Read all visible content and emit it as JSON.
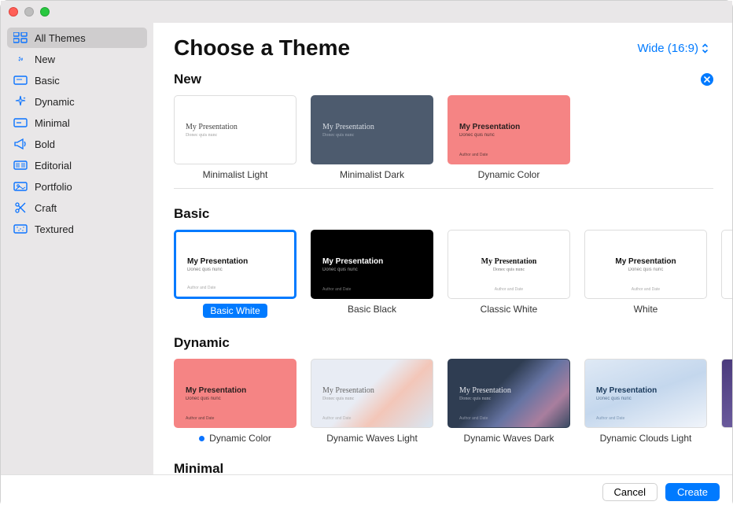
{
  "window": {
    "title": "Choose a Theme",
    "aspect_label": "Wide (16:9)"
  },
  "sidebar": {
    "items": [
      {
        "label": "All Themes",
        "active": true
      },
      {
        "label": "New",
        "active": false
      },
      {
        "label": "Basic",
        "active": false
      },
      {
        "label": "Dynamic",
        "active": false
      },
      {
        "label": "Minimal",
        "active": false
      },
      {
        "label": "Bold",
        "active": false
      },
      {
        "label": "Editorial",
        "active": false
      },
      {
        "label": "Portfolio",
        "active": false
      },
      {
        "label": "Craft",
        "active": false
      },
      {
        "label": "Textured",
        "active": false
      }
    ]
  },
  "sections": {
    "new": {
      "title": "New",
      "themes": [
        {
          "label": "Minimalist Light"
        },
        {
          "label": "Minimalist Dark"
        },
        {
          "label": "Dynamic Color"
        }
      ]
    },
    "basic": {
      "title": "Basic",
      "themes": [
        {
          "label": "Basic White",
          "selected": true
        },
        {
          "label": "Basic Black"
        },
        {
          "label": "Classic White"
        },
        {
          "label": "White"
        }
      ]
    },
    "dynamic": {
      "title": "Dynamic",
      "themes": [
        {
          "label": "Dynamic Color",
          "new": true
        },
        {
          "label": "Dynamic Waves Light"
        },
        {
          "label": "Dynamic Waves Dark"
        },
        {
          "label": "Dynamic Clouds Light"
        }
      ]
    },
    "minimal": {
      "title": "Minimal"
    }
  },
  "sample": {
    "title": "My Presentation",
    "subtitle": "Donec quis nunc",
    "footer": "Author and Date"
  },
  "footer": {
    "cancel": "Cancel",
    "create": "Create"
  }
}
